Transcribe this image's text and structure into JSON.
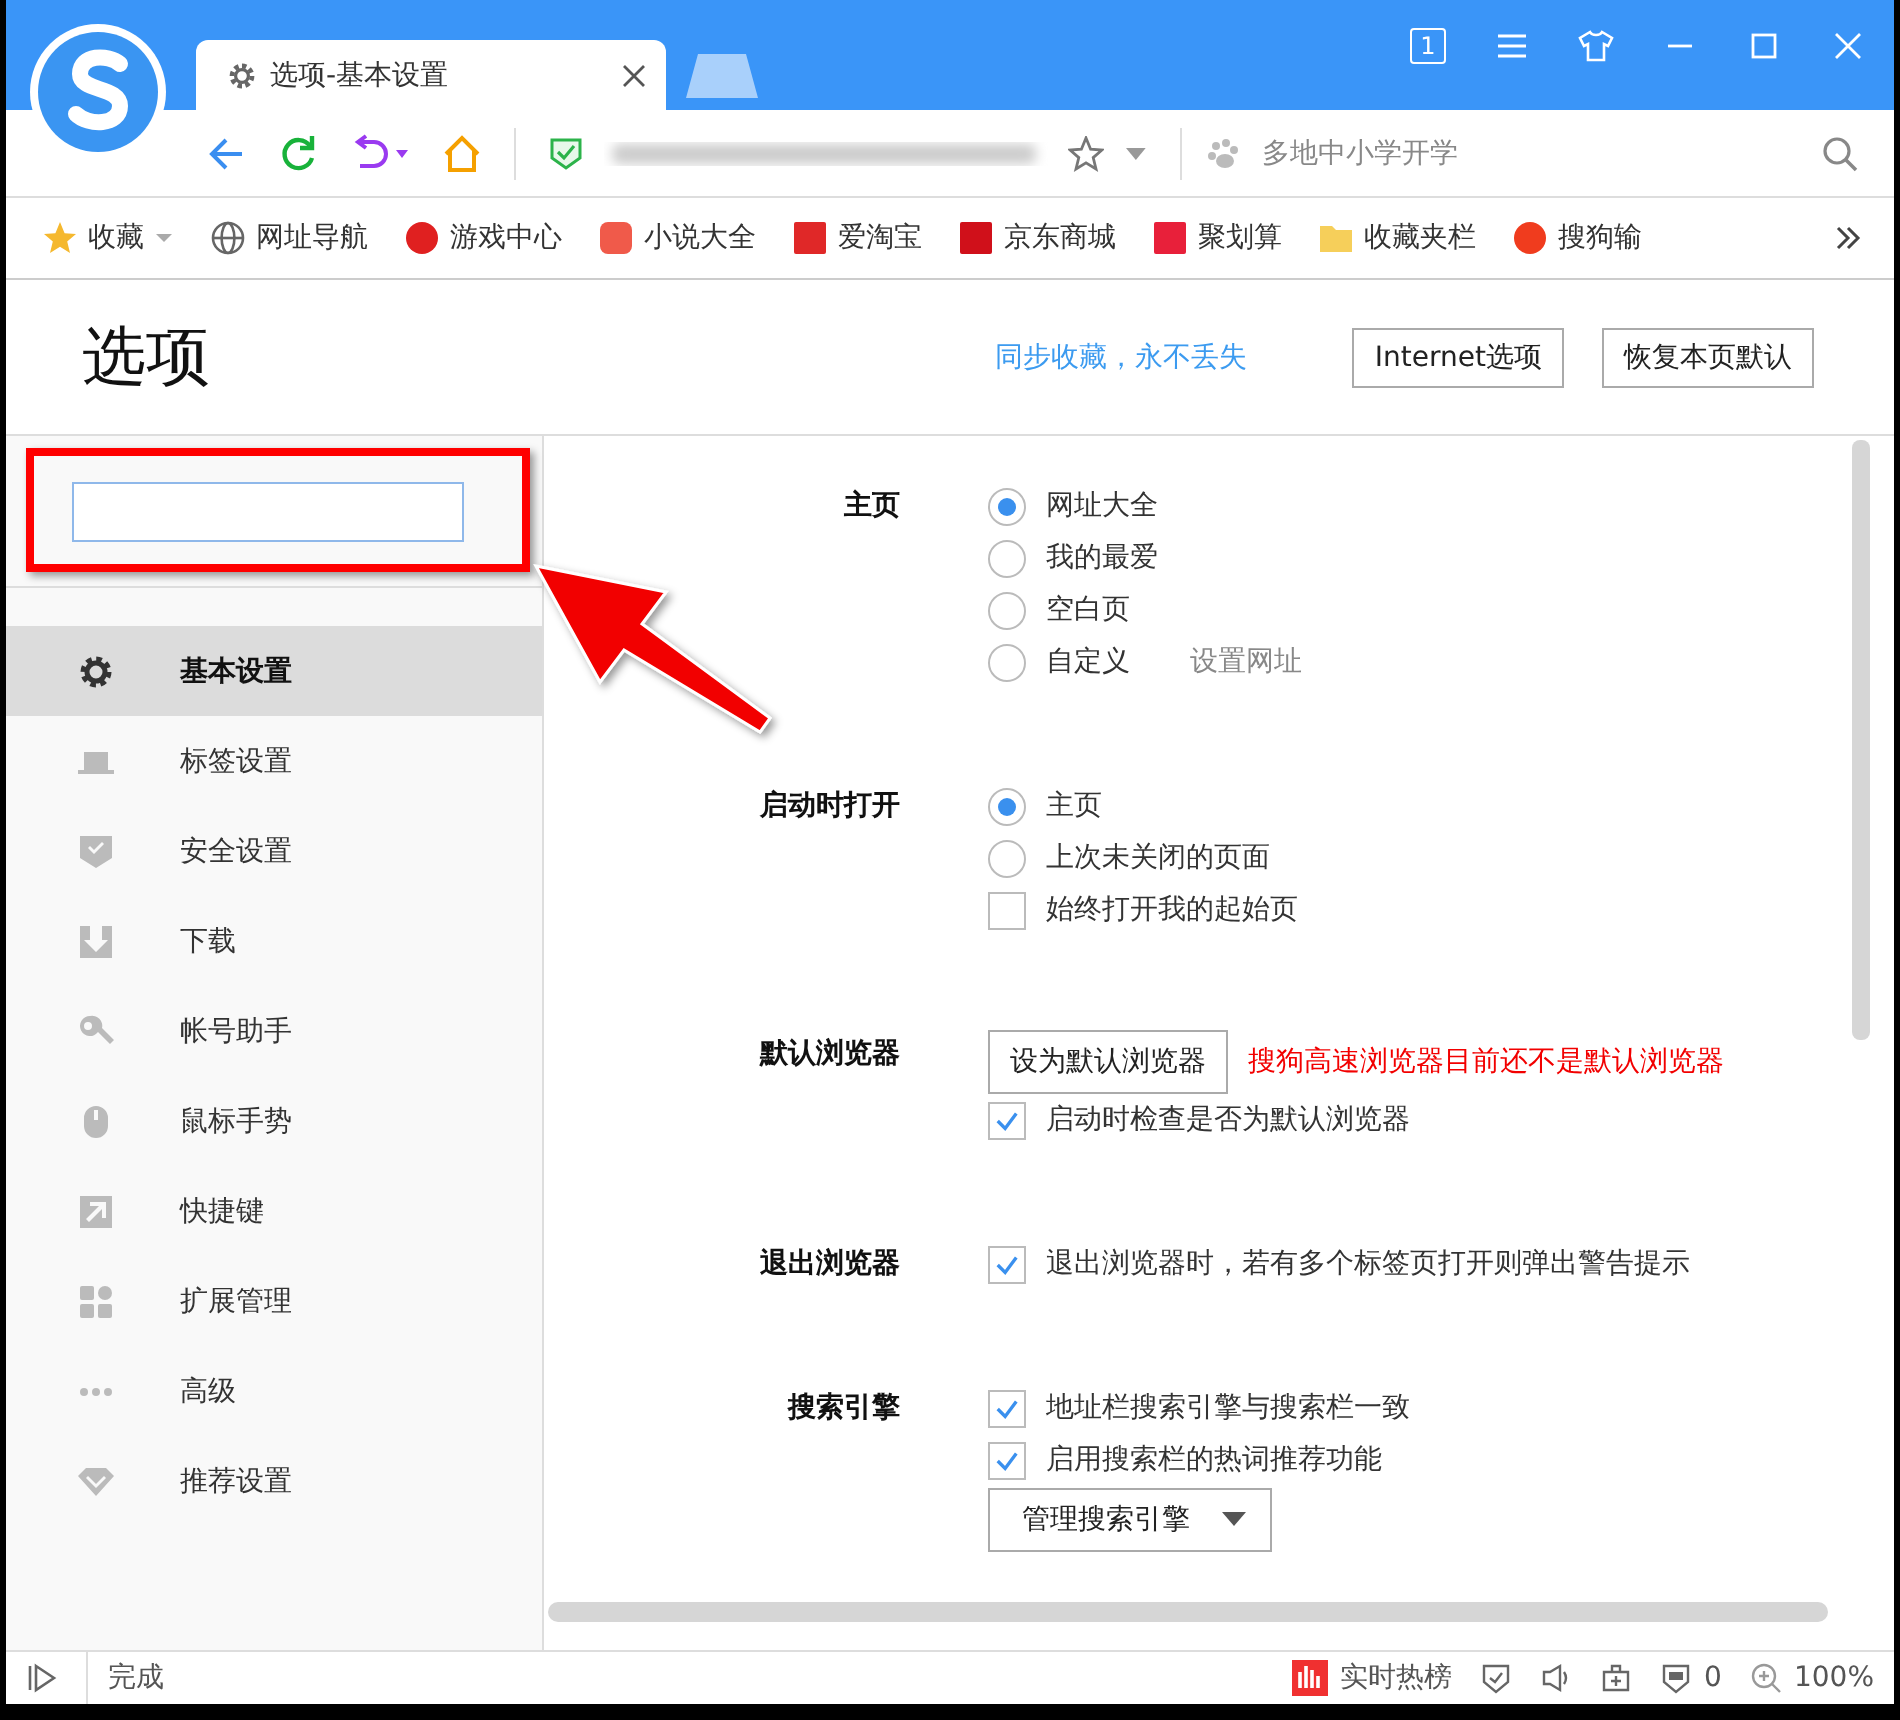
{
  "browser_tab": {
    "title": "选项-基本设置",
    "selected": true
  },
  "tab_count": "1",
  "toolbar": {
    "search_placeholder": "多地中小学开学"
  },
  "bookmarks": [
    {
      "label": "收藏",
      "kind": "star"
    },
    {
      "label": "网址导航",
      "kind": "globe"
    },
    {
      "label": "游戏中心",
      "kind": "game"
    },
    {
      "label": "小说大全",
      "kind": "novel"
    },
    {
      "label": "爱淘宝",
      "kind": "taobao"
    },
    {
      "label": "京东商城",
      "kind": "jd"
    },
    {
      "label": "聚划算",
      "kind": "deal"
    },
    {
      "label": "收藏夹栏",
      "kind": "folder"
    },
    {
      "label": "搜狗输",
      "kind": "sogou"
    }
  ],
  "header": {
    "title": "选项",
    "sync_link": "同步收藏，永不丢失",
    "buttons": [
      "Internet选项",
      "恢复本页默认"
    ]
  },
  "sidebar": [
    {
      "label": "基本设置",
      "kind": "gear",
      "selected": true
    },
    {
      "label": "标签设置",
      "kind": "tab",
      "selected": false
    },
    {
      "label": "安全设置",
      "kind": "shield",
      "selected": false
    },
    {
      "label": "下载",
      "kind": "download",
      "selected": false
    },
    {
      "label": "帐号助手",
      "kind": "key",
      "selected": false
    },
    {
      "label": "鼠标手势",
      "kind": "mouse",
      "selected": false
    },
    {
      "label": "快捷键",
      "kind": "shortcut",
      "selected": false
    },
    {
      "label": "扩展管理",
      "kind": "grid",
      "selected": false
    },
    {
      "label": "高级",
      "kind": "dots",
      "selected": false
    },
    {
      "label": "推荐设置",
      "kind": "diamond",
      "selected": false
    }
  ],
  "sections": [
    {
      "label": "主页",
      "controls": [
        {
          "kind": "radio",
          "label": "网址大全",
          "selected": true
        },
        {
          "kind": "radio",
          "label": "我的最爱",
          "selected": false
        },
        {
          "kind": "radio",
          "label": "空白页",
          "selected": false
        },
        {
          "kind": "radio",
          "label": "自定义",
          "selected": false,
          "link": "设置网址"
        }
      ]
    },
    {
      "label": "启动时打开",
      "controls": [
        {
          "kind": "radio",
          "label": "主页",
          "selected": true
        },
        {
          "kind": "radio",
          "label": "上次未关闭的页面",
          "selected": false
        },
        {
          "kind": "checkbox",
          "label": "始终打开我的起始页",
          "checked": false
        }
      ]
    },
    {
      "label": "默认浏览器",
      "controls": [
        {
          "kind": "button",
          "label": "设为默认浏览器",
          "note": "搜狗高速浏览器目前还不是默认浏览器"
        },
        {
          "kind": "checkbox",
          "label": "启动时检查是否为默认浏览器",
          "checked": true
        }
      ]
    },
    {
      "label": "退出浏览器",
      "controls": [
        {
          "kind": "checkbox",
          "label": "退出浏览器时，若有多个标签页打开则弹出警告提示",
          "checked": true
        }
      ]
    },
    {
      "label": "搜索引擎",
      "controls": [
        {
          "kind": "checkbox",
          "label": "地址栏搜索引擎与搜索栏一致",
          "checked": true
        },
        {
          "kind": "checkbox",
          "label": "启用搜索栏的热词推荐功能",
          "checked": true
        },
        {
          "kind": "dropdown",
          "label": "管理搜索引擎"
        }
      ]
    }
  ],
  "status_bar": {
    "status": "完成",
    "hot_list": "实时热榜",
    "ad_count": "0",
    "zoom": "100%"
  }
}
